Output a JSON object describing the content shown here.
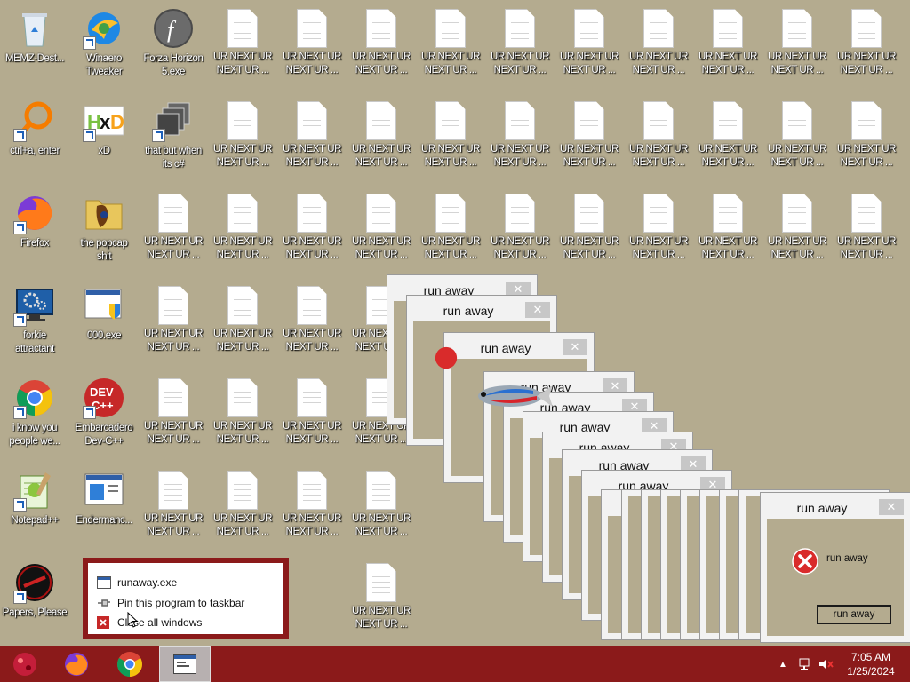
{
  "desktop": {
    "icons": [
      {
        "id": "recycle-bin",
        "label": "MEMZ-Dest...",
        "icon": "recycle-bin-icon"
      },
      {
        "id": "winaero",
        "label": "Winaero\nTweaker",
        "icon": "winaero-icon"
      },
      {
        "id": "forza",
        "label": "Forza Horizon\n5.exe",
        "icon": "flash-icon"
      },
      {
        "id": "ctrl-a",
        "label": "ctrl+a, enter",
        "icon": "magnifier-icon"
      },
      {
        "id": "xd",
        "label": "xD",
        "icon": "hxd-icon"
      },
      {
        "id": "that-but",
        "label": "that but when\nits c#",
        "icon": "stack-icon"
      },
      {
        "id": "firefox",
        "label": "Firefox",
        "icon": "firefox-icon"
      },
      {
        "id": "popcap",
        "label": "the popcap\nshit",
        "icon": "folder-icon"
      },
      {
        "id": "forkie",
        "label": "forkie\nattractant",
        "icon": "monitor-gear-icon"
      },
      {
        "id": "000exe",
        "label": "000.exe",
        "icon": "shield-window-icon"
      },
      {
        "id": "chrome",
        "label": "i know you\npeople we...",
        "icon": "chrome-icon"
      },
      {
        "id": "devcpp",
        "label": "Embarcadero\nDev-C++",
        "icon": "devcpp-icon"
      },
      {
        "id": "notepadpp",
        "label": "Notepad++",
        "icon": "notepadpp-icon"
      },
      {
        "id": "enderman",
        "label": "Endermanc...",
        "icon": "app-window-icon"
      },
      {
        "id": "papers",
        "label": "Papers, Please",
        "icon": "papers-please-icon"
      }
    ],
    "file_label": "UR NEXT UR\nNEXT UR ...",
    "file_icon": "text-file-icon"
  },
  "popups": {
    "title": "run away",
    "message": "run away",
    "button": "run away",
    "close_glyph": "✕"
  },
  "taskbar": {
    "time": "7:05 AM",
    "date": "1/25/2024",
    "apps": [
      "memz-icon",
      "firefox-icon",
      "chrome-icon",
      "runaway-app-icon"
    ],
    "tray": [
      "chevron-up-icon",
      "network-icon",
      "volume-muted-icon"
    ]
  },
  "jumplist": {
    "app": "runaway.exe",
    "pin": "Pin this program to taskbar",
    "close": "Close all windows"
  },
  "colors": {
    "desktop": "#b4ab8f",
    "taskbar": "#8b1a1a",
    "error_red": "#d92b2b"
  }
}
